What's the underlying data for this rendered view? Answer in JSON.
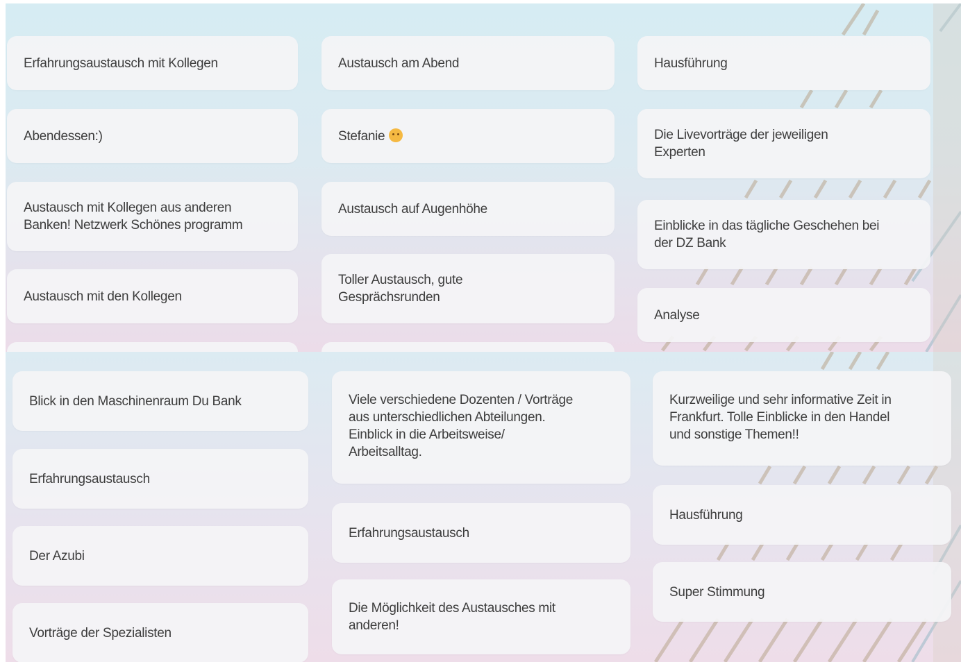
{
  "top_panel": {
    "col1": [
      "Erfahrungsaustausch mit Kollegen",
      "Abendessen:)",
      "Austausch mit Kollegen aus anderen\nBanken! Netzwerk Schönes programm",
      "Austausch mit den Kollegen"
    ],
    "col2": [
      "Austausch am Abend",
      "Stefanie",
      "Austausch auf Augenhöhe",
      "Toller Austausch, gute\nGesprächsrunden"
    ],
    "col3": [
      "Hausführung",
      "Die Livevorträge der jeweiligen\nExperten",
      "Einblicke in das tägliche Geschehen bei\nder DZ Bank",
      "Analyse"
    ]
  },
  "bottom_panel": {
    "col1": [
      "Blick in den Maschinenraum Du Bank",
      "Erfahrungsaustausch",
      "Der Azubi",
      "Vorträge der Spezialisten"
    ],
    "col2": [
      "Viele verschiedene Dozenten / Vorträge\naus unterschiedlichen Abteilungen.\nEinblick in die Arbeitsweise/\nArbeitsalltag.",
      "Erfahrungsaustausch",
      "Die Möglichkeit des Austausches mit\nanderen!"
    ],
    "col3": [
      "Kurzweilige und sehr informative Zeit in\nFrankfurt. Tolle Einblicke in den Handel\nund sonstige Themen!!",
      "Hausführung",
      "Super Stimmung"
    ]
  },
  "emoji": "hugging-face-icon",
  "colors": {
    "card": "#f4f4f6",
    "text": "#3d3d3d",
    "bg_blue": "#d6ecf3",
    "bg_pink": "#ecdce9"
  }
}
